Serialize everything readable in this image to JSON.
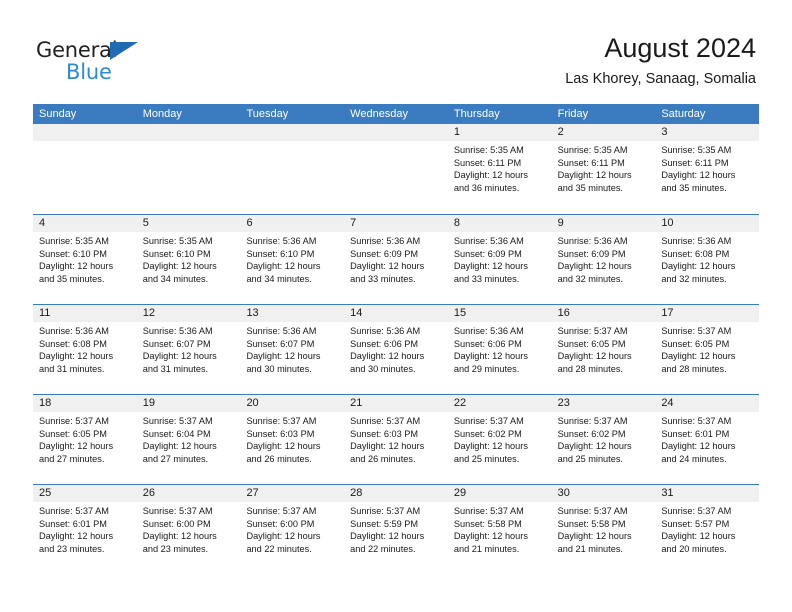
{
  "brand": {
    "name_part1": "General",
    "name_part2": "Blue",
    "accent_color": "#2e8ad4",
    "triangle_color": "#1f6cb4"
  },
  "header": {
    "title": "August 2024",
    "subtitle": "Las Khorey, Sanaag, Somalia"
  },
  "calendar": {
    "header_color": "#3a7cbf",
    "daynum_band_color": "#f0f0f0",
    "weekdays": [
      "Sunday",
      "Monday",
      "Tuesday",
      "Wednesday",
      "Thursday",
      "Friday",
      "Saturday"
    ],
    "weeks": [
      [
        {
          "day": "",
          "empty": true
        },
        {
          "day": "",
          "empty": true
        },
        {
          "day": "",
          "empty": true
        },
        {
          "day": "",
          "empty": true
        },
        {
          "day": "1",
          "sunrise": "Sunrise: 5:35 AM",
          "sunset": "Sunset: 6:11 PM",
          "daylight_l1": "Daylight: 12 hours",
          "daylight_l2": "and 36 minutes."
        },
        {
          "day": "2",
          "sunrise": "Sunrise: 5:35 AM",
          "sunset": "Sunset: 6:11 PM",
          "daylight_l1": "Daylight: 12 hours",
          "daylight_l2": "and 35 minutes."
        },
        {
          "day": "3",
          "sunrise": "Sunrise: 5:35 AM",
          "sunset": "Sunset: 6:11 PM",
          "daylight_l1": "Daylight: 12 hours",
          "daylight_l2": "and 35 minutes."
        }
      ],
      [
        {
          "day": "4",
          "sunrise": "Sunrise: 5:35 AM",
          "sunset": "Sunset: 6:10 PM",
          "daylight_l1": "Daylight: 12 hours",
          "daylight_l2": "and 35 minutes."
        },
        {
          "day": "5",
          "sunrise": "Sunrise: 5:35 AM",
          "sunset": "Sunset: 6:10 PM",
          "daylight_l1": "Daylight: 12 hours",
          "daylight_l2": "and 34 minutes."
        },
        {
          "day": "6",
          "sunrise": "Sunrise: 5:36 AM",
          "sunset": "Sunset: 6:10 PM",
          "daylight_l1": "Daylight: 12 hours",
          "daylight_l2": "and 34 minutes."
        },
        {
          "day": "7",
          "sunrise": "Sunrise: 5:36 AM",
          "sunset": "Sunset: 6:09 PM",
          "daylight_l1": "Daylight: 12 hours",
          "daylight_l2": "and 33 minutes."
        },
        {
          "day": "8",
          "sunrise": "Sunrise: 5:36 AM",
          "sunset": "Sunset: 6:09 PM",
          "daylight_l1": "Daylight: 12 hours",
          "daylight_l2": "and 33 minutes."
        },
        {
          "day": "9",
          "sunrise": "Sunrise: 5:36 AM",
          "sunset": "Sunset: 6:09 PM",
          "daylight_l1": "Daylight: 12 hours",
          "daylight_l2": "and 32 minutes."
        },
        {
          "day": "10",
          "sunrise": "Sunrise: 5:36 AM",
          "sunset": "Sunset: 6:08 PM",
          "daylight_l1": "Daylight: 12 hours",
          "daylight_l2": "and 32 minutes."
        }
      ],
      [
        {
          "day": "11",
          "sunrise": "Sunrise: 5:36 AM",
          "sunset": "Sunset: 6:08 PM",
          "daylight_l1": "Daylight: 12 hours",
          "daylight_l2": "and 31 minutes."
        },
        {
          "day": "12",
          "sunrise": "Sunrise: 5:36 AM",
          "sunset": "Sunset: 6:07 PM",
          "daylight_l1": "Daylight: 12 hours",
          "daylight_l2": "and 31 minutes."
        },
        {
          "day": "13",
          "sunrise": "Sunrise: 5:36 AM",
          "sunset": "Sunset: 6:07 PM",
          "daylight_l1": "Daylight: 12 hours",
          "daylight_l2": "and 30 minutes."
        },
        {
          "day": "14",
          "sunrise": "Sunrise: 5:36 AM",
          "sunset": "Sunset: 6:06 PM",
          "daylight_l1": "Daylight: 12 hours",
          "daylight_l2": "and 30 minutes."
        },
        {
          "day": "15",
          "sunrise": "Sunrise: 5:36 AM",
          "sunset": "Sunset: 6:06 PM",
          "daylight_l1": "Daylight: 12 hours",
          "daylight_l2": "and 29 minutes."
        },
        {
          "day": "16",
          "sunrise": "Sunrise: 5:37 AM",
          "sunset": "Sunset: 6:05 PM",
          "daylight_l1": "Daylight: 12 hours",
          "daylight_l2": "and 28 minutes."
        },
        {
          "day": "17",
          "sunrise": "Sunrise: 5:37 AM",
          "sunset": "Sunset: 6:05 PM",
          "daylight_l1": "Daylight: 12 hours",
          "daylight_l2": "and 28 minutes."
        }
      ],
      [
        {
          "day": "18",
          "sunrise": "Sunrise: 5:37 AM",
          "sunset": "Sunset: 6:05 PM",
          "daylight_l1": "Daylight: 12 hours",
          "daylight_l2": "and 27 minutes."
        },
        {
          "day": "19",
          "sunrise": "Sunrise: 5:37 AM",
          "sunset": "Sunset: 6:04 PM",
          "daylight_l1": "Daylight: 12 hours",
          "daylight_l2": "and 27 minutes."
        },
        {
          "day": "20",
          "sunrise": "Sunrise: 5:37 AM",
          "sunset": "Sunset: 6:03 PM",
          "daylight_l1": "Daylight: 12 hours",
          "daylight_l2": "and 26 minutes."
        },
        {
          "day": "21",
          "sunrise": "Sunrise: 5:37 AM",
          "sunset": "Sunset: 6:03 PM",
          "daylight_l1": "Daylight: 12 hours",
          "daylight_l2": "and 26 minutes."
        },
        {
          "day": "22",
          "sunrise": "Sunrise: 5:37 AM",
          "sunset": "Sunset: 6:02 PM",
          "daylight_l1": "Daylight: 12 hours",
          "daylight_l2": "and 25 minutes."
        },
        {
          "day": "23",
          "sunrise": "Sunrise: 5:37 AM",
          "sunset": "Sunset: 6:02 PM",
          "daylight_l1": "Daylight: 12 hours",
          "daylight_l2": "and 25 minutes."
        },
        {
          "day": "24",
          "sunrise": "Sunrise: 5:37 AM",
          "sunset": "Sunset: 6:01 PM",
          "daylight_l1": "Daylight: 12 hours",
          "daylight_l2": "and 24 minutes."
        }
      ],
      [
        {
          "day": "25",
          "sunrise": "Sunrise: 5:37 AM",
          "sunset": "Sunset: 6:01 PM",
          "daylight_l1": "Daylight: 12 hours",
          "daylight_l2": "and 23 minutes."
        },
        {
          "day": "26",
          "sunrise": "Sunrise: 5:37 AM",
          "sunset": "Sunset: 6:00 PM",
          "daylight_l1": "Daylight: 12 hours",
          "daylight_l2": "and 23 minutes."
        },
        {
          "day": "27",
          "sunrise": "Sunrise: 5:37 AM",
          "sunset": "Sunset: 6:00 PM",
          "daylight_l1": "Daylight: 12 hours",
          "daylight_l2": "and 22 minutes."
        },
        {
          "day": "28",
          "sunrise": "Sunrise: 5:37 AM",
          "sunset": "Sunset: 5:59 PM",
          "daylight_l1": "Daylight: 12 hours",
          "daylight_l2": "and 22 minutes."
        },
        {
          "day": "29",
          "sunrise": "Sunrise: 5:37 AM",
          "sunset": "Sunset: 5:58 PM",
          "daylight_l1": "Daylight: 12 hours",
          "daylight_l2": "and 21 minutes."
        },
        {
          "day": "30",
          "sunrise": "Sunrise: 5:37 AM",
          "sunset": "Sunset: 5:58 PM",
          "daylight_l1": "Daylight: 12 hours",
          "daylight_l2": "and 21 minutes."
        },
        {
          "day": "31",
          "sunrise": "Sunrise: 5:37 AM",
          "sunset": "Sunset: 5:57 PM",
          "daylight_l1": "Daylight: 12 hours",
          "daylight_l2": "and 20 minutes."
        }
      ]
    ]
  }
}
